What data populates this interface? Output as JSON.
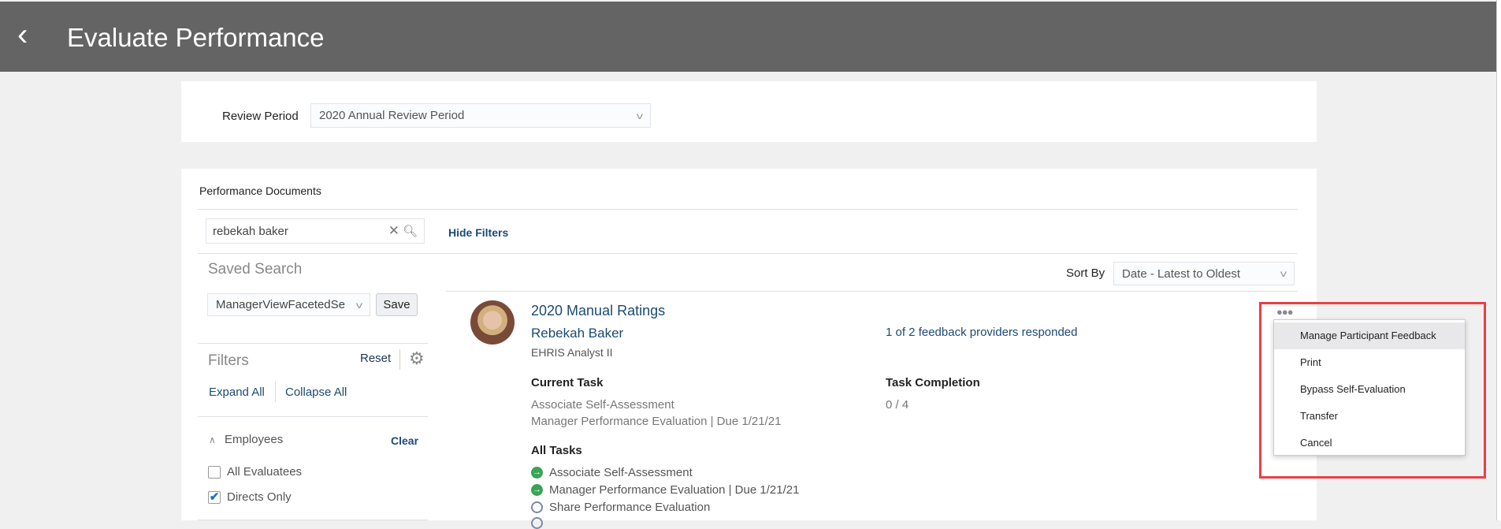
{
  "header": {
    "title": "Evaluate Performance",
    "back_icon": "chevron-left-icon"
  },
  "review": {
    "label": "Review Period",
    "value": "2020 Annual Review Period"
  },
  "docs": {
    "heading": "Performance Documents",
    "search_value": "rebekah baker",
    "hide_filters": "Hide Filters",
    "saved_search_label": "Saved Search",
    "saved_search_value": "ManagerViewFacetedSe",
    "save_label": "Save",
    "filters_label": "Filters",
    "reset_label": "Reset",
    "expand_all": "Expand All",
    "collapse_all": "Collapse All",
    "employees_label": "Employees",
    "clear_label": "Clear",
    "options": [
      {
        "label": "All Evaluatees",
        "checked": false
      },
      {
        "label": "Directs Only",
        "checked": true
      }
    ],
    "sort_label": "Sort By",
    "sort_value": "Date - Latest to Oldest"
  },
  "document": {
    "title": "2020 Manual Ratings",
    "name": "Rebekah Baker",
    "job": "EHRIS Analyst II",
    "feedback": "1 of 2 feedback providers responded",
    "current_task_label": "Current Task",
    "current_tasks": [
      "Associate Self-Assessment",
      "Manager Performance Evaluation | Due 1/21/21"
    ],
    "completion_label": "Task Completion",
    "completion_value": "0 / 4",
    "all_tasks_label": "All Tasks",
    "all_tasks": [
      {
        "label": "Associate Self-Assessment",
        "status": "in-progress"
      },
      {
        "label": "Manager Performance Evaluation | Due 1/21/21",
        "status": "in-progress"
      },
      {
        "label": "Share Performance Evaluation",
        "status": "not-started"
      }
    ]
  },
  "menu": {
    "items": [
      "Manage Participant Feedback",
      "Print",
      "Bypass Self-Evaluation",
      "Transfer",
      "Cancel"
    ]
  },
  "colors": {
    "header": "#646464",
    "link": "#1b4a75",
    "highlight": "#ec3e46",
    "done": "#3aa455"
  }
}
